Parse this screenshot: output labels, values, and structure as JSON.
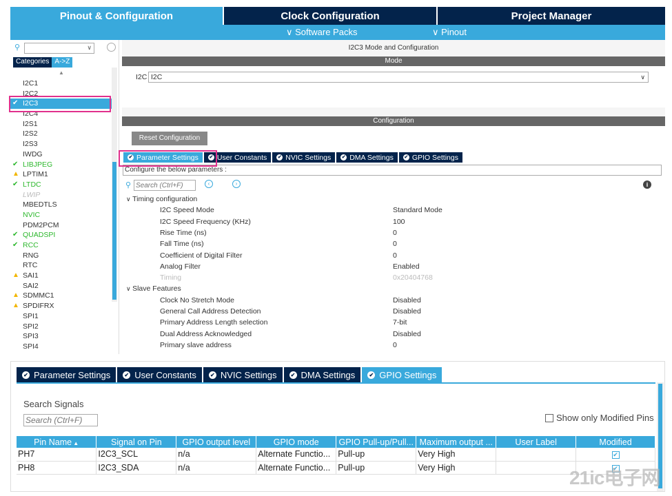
{
  "top_tabs": [
    "Pinout & Configuration",
    "Clock Configuration",
    "Project Manager"
  ],
  "sub_menu": {
    "software_packs": "Software Packs",
    "pinout": "Pinout"
  },
  "left": {
    "categories_tab": "Categories",
    "az_tab": "A->Z",
    "items": [
      {
        "label": "I2C1",
        "status": "none"
      },
      {
        "label": "I2C2",
        "status": "none"
      },
      {
        "label": "I2C3",
        "status": "selected"
      },
      {
        "label": "I2C4",
        "status": "none"
      },
      {
        "label": "I2S1",
        "status": "none"
      },
      {
        "label": "I2S2",
        "status": "none"
      },
      {
        "label": "I2S3",
        "status": "none"
      },
      {
        "label": "IWDG",
        "status": "none"
      },
      {
        "label": "LIBJPEG",
        "status": "ok"
      },
      {
        "label": "LPTIM1",
        "status": "warn"
      },
      {
        "label": "LTDC",
        "status": "ok"
      },
      {
        "label": "LWIP",
        "status": "disabled"
      },
      {
        "label": "MBEDTLS",
        "status": "none"
      },
      {
        "label": "NVIC",
        "status": "green"
      },
      {
        "label": "PDM2PCM",
        "status": "none"
      },
      {
        "label": "QUADSPI",
        "status": "ok"
      },
      {
        "label": "RCC",
        "status": "ok"
      },
      {
        "label": "RNG",
        "status": "none"
      },
      {
        "label": "RTC",
        "status": "none"
      },
      {
        "label": "SAI1",
        "status": "warn"
      },
      {
        "label": "SAI2",
        "status": "none"
      },
      {
        "label": "SDMMC1",
        "status": "warn"
      },
      {
        "label": "SPDIFRX",
        "status": "warn"
      },
      {
        "label": "SPI1",
        "status": "none"
      },
      {
        "label": "SPI2",
        "status": "none"
      },
      {
        "label": "SPI3",
        "status": "none"
      },
      {
        "label": "SPI4",
        "status": "none"
      }
    ]
  },
  "main": {
    "title": "I2C3 Mode and Configuration",
    "mode_header": "Mode",
    "i2c_label": "I2C",
    "i2c_value": "I2C",
    "config_header": "Configuration",
    "reset_button": "Reset Configuration",
    "tabs": [
      "Parameter Settings",
      "User Constants",
      "NVIC Settings",
      "DMA Settings",
      "GPIO Settings"
    ],
    "configure_text": "Configure the below parameters :",
    "search_placeholder": "Search (Ctrl+F)",
    "sections": [
      {
        "title": "Timing configuration",
        "params": [
          {
            "name": "I2C Speed Mode",
            "value": "Standard Mode",
            "disabled": false
          },
          {
            "name": "I2C Speed Frequency (KHz)",
            "value": "100",
            "disabled": false
          },
          {
            "name": "Rise Time (ns)",
            "value": "0",
            "disabled": false
          },
          {
            "name": "Fall Time (ns)",
            "value": "0",
            "disabled": false
          },
          {
            "name": "Coefficient of Digital Filter",
            "value": "0",
            "disabled": false
          },
          {
            "name": "Analog Filter",
            "value": "Enabled",
            "disabled": false
          },
          {
            "name": "Timing",
            "value": "0x20404768",
            "disabled": true
          }
        ]
      },
      {
        "title": "Slave Features",
        "params": [
          {
            "name": "Clock No Stretch Mode",
            "value": "Disabled",
            "disabled": false
          },
          {
            "name": "General Call Address Detection",
            "value": "Disabled",
            "disabled": false
          },
          {
            "name": "Primary Address Length selection",
            "value": "7-bit",
            "disabled": false
          },
          {
            "name": "Dual Address Acknowledged",
            "value": "Disabled",
            "disabled": false
          },
          {
            "name": "Primary slave address",
            "value": "0",
            "disabled": false
          }
        ]
      }
    ]
  },
  "bottom": {
    "tabs": [
      "Parameter Settings",
      "User Constants",
      "NVIC Settings",
      "DMA Settings",
      "GPIO Settings"
    ],
    "search_signals_label": "Search Signals",
    "search_placeholder": "Search (Ctrl+F)",
    "show_modified_label": "Show only Modified Pins",
    "columns": [
      "Pin Name",
      "Signal on Pin",
      "GPIO output level",
      "GPIO mode",
      "GPIO Pull-up/Pull...",
      "Maximum output ...",
      "User Label",
      "Modified"
    ],
    "rows": [
      {
        "pin": "PH7",
        "signal": "I2C3_SCL",
        "level": "n/a",
        "mode": "Alternate Functio...",
        "pull": "Pull-up",
        "speed": "Very High",
        "label": "",
        "modified": true
      },
      {
        "pin": "PH8",
        "signal": "I2C3_SDA",
        "level": "n/a",
        "mode": "Alternate Functio...",
        "pull": "Pull-up",
        "speed": "Very High",
        "label": "",
        "modified": true
      }
    ]
  },
  "watermark": "21ic电子网",
  "colors": {
    "navy": "#03234b",
    "accent": "#39a9dc",
    "highlight": "#e0308c",
    "ok": "#2db82d",
    "warn": "#f2b600"
  }
}
